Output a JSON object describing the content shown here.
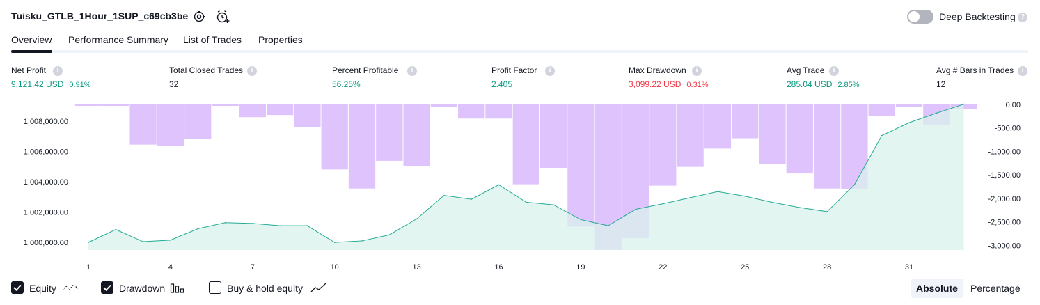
{
  "header": {
    "strategy_name": "Tuisku_GTLB_1Hour_1SUP_c69cb3be",
    "settings_icon": "gear-icon",
    "alert_icon": "add-alert-clock-icon",
    "deep_backtesting_label": "Deep Backtesting",
    "deep_backtesting_enabled": false,
    "help_icon": "question-icon"
  },
  "tabs": [
    {
      "label": "Overview",
      "active": true
    },
    {
      "label": "Performance Summary",
      "active": false
    },
    {
      "label": "List of Trades",
      "active": false
    },
    {
      "label": "Properties",
      "active": false
    }
  ],
  "stats": [
    {
      "label": "Net Profit",
      "value": "9,121.42 USD",
      "pct": "0.91%",
      "color": "green"
    },
    {
      "label": "Total Closed Trades",
      "value": "32",
      "pct": "",
      "color": "neutral"
    },
    {
      "label": "Percent Profitable",
      "value": "56.25%",
      "pct": "",
      "color": "green"
    },
    {
      "label": "Profit Factor",
      "value": "2.405",
      "pct": "",
      "color": "green"
    },
    {
      "label": "Max Drawdown",
      "value": "3,099.22 USD",
      "pct": "0.31%",
      "color": "red"
    },
    {
      "label": "Avg Trade",
      "value": "285.04 USD",
      "pct": "2.85%",
      "color": "green"
    },
    {
      "label": "Avg # Bars in Trades",
      "value": "12",
      "pct": "",
      "color": "neutral"
    }
  ],
  "colors": {
    "equity_line": "#22ab94",
    "equity_fill": "#d9f2ec",
    "drawdown_bar": "#dfc3fc",
    "overlap": "#b9b3e6",
    "positive": "#089981",
    "negative": "#f23645"
  },
  "chart_data": {
    "type": "area",
    "x_ticks": [
      "1",
      "4",
      "7",
      "10",
      "13",
      "16",
      "19",
      "22",
      "25",
      "28",
      "31"
    ],
    "y_left_ticks": [
      "1,000,000.00",
      "1,002,000.00",
      "1,004,000.00",
      "1,006,000.00",
      "1,008,000.00"
    ],
    "y_right_ticks": [
      "0.00",
      "-500.00",
      "-1,000.00",
      "-1,500.00",
      "-2,000.00",
      "-2,500.00",
      "-3,000.00"
    ],
    "y_left_range": [
      999500,
      1009100
    ],
    "y_right_range": [
      -3100,
      0
    ],
    "grid": false,
    "series": [
      {
        "name": "Equity",
        "type": "area",
        "axis": "left",
        "x": [
          1,
          2,
          3,
          4,
          5,
          6,
          7,
          8,
          9,
          10,
          11,
          12,
          13,
          14,
          15,
          16,
          17,
          18,
          19,
          20,
          21,
          22,
          23,
          24,
          25,
          26,
          27,
          28,
          29,
          30,
          31,
          32,
          33
        ],
        "values": [
          1000000,
          1000850,
          1000050,
          1000150,
          1000900,
          1001300,
          1001250,
          1001100,
          1001100,
          1000000,
          1000100,
          1000500,
          1001550,
          1003100,
          1002850,
          1003800,
          1002650,
          1002480,
          1001500,
          1001100,
          1002180,
          1002550,
          1002950,
          1003350,
          1003050,
          1002640,
          1002300,
          1002030,
          1003800,
          1007050,
          1007900,
          1008530,
          1009120
        ]
      },
      {
        "name": "Drawdown",
        "type": "bar",
        "axis": "right",
        "x": [
          1,
          2,
          3,
          4,
          5,
          6,
          7,
          8,
          9,
          10,
          11,
          12,
          13,
          14,
          15,
          16,
          17,
          18,
          19,
          20,
          21,
          22,
          23,
          24,
          25,
          26,
          27,
          28,
          29,
          30,
          31,
          32,
          33
        ],
        "values": [
          -10,
          -10,
          -855,
          -885,
          -740,
          -10,
          -270,
          -225,
          -490,
          -1385,
          -1790,
          -1200,
          -1320,
          -50,
          -300,
          -300,
          -1700,
          -1350,
          -2600,
          -3099,
          -2850,
          -1730,
          -1330,
          -940,
          -720,
          -1270,
          -1470,
          -1790,
          -1800,
          -250,
          -50,
          -430,
          -100
        ]
      },
      {
        "name": "Buy & hold equity",
        "type": "line",
        "axis": "left",
        "visible": false,
        "values": []
      }
    ]
  },
  "legend": [
    {
      "label": "Equity",
      "checked": true,
      "icon": "equity-wave-icon"
    },
    {
      "label": "Drawdown",
      "checked": true,
      "icon": "drawdown-bars-icon"
    },
    {
      "label": "Buy & hold equity",
      "checked": false,
      "icon": "buy-hold-line-icon"
    }
  ],
  "view_mode": {
    "options": [
      "Absolute",
      "Percentage"
    ],
    "selected": "Absolute"
  }
}
